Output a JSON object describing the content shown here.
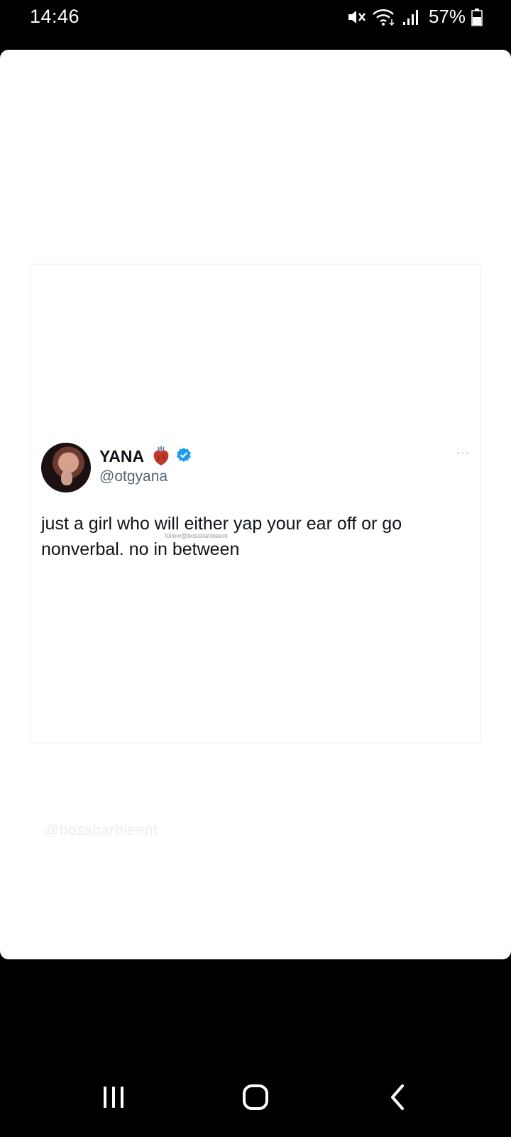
{
  "status_bar": {
    "time": "14:46",
    "battery_percent": "57%",
    "icons": [
      "mute-icon",
      "wifi-icon",
      "signal-icon",
      "battery-icon"
    ]
  },
  "post": {
    "author_name": "YANA",
    "author_handle": "@otgyana",
    "text": "just a girl who will either yap your ear off or go nonverbal. no in between",
    "inline_watermark": "follow@bossbarbieent",
    "badges": [
      "anatomical-heart-icon",
      "verified-badge-icon"
    ],
    "verified_color": "#1d9bf0",
    "more_label": "···"
  },
  "watermark": "@bossbarbieent",
  "nav_bar": {
    "icons": [
      "recent-apps-icon",
      "home-icon",
      "back-icon"
    ]
  }
}
